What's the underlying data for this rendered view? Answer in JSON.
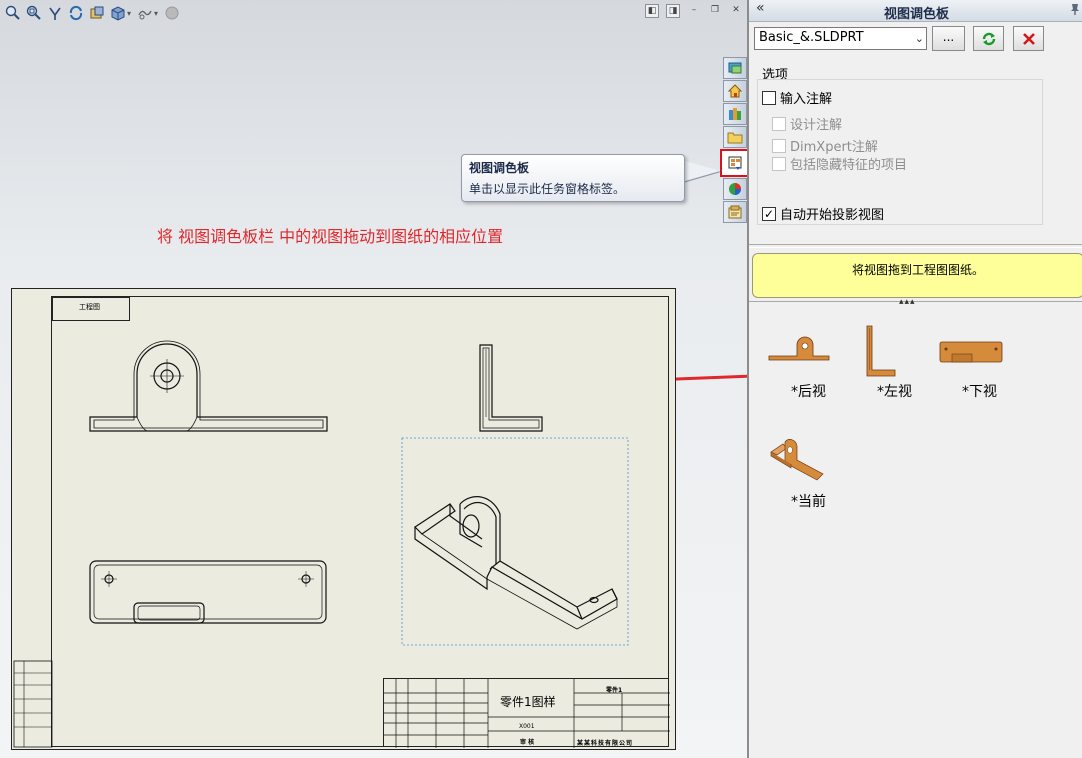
{
  "graphics": {
    "toolbar_icons": [
      "zoom-to-fit-icon",
      "zoom-area-icon",
      "previous-view-icon",
      "rebuild-icon",
      "section-view-icon",
      "view-orientation-icon",
      "display-style-icon",
      "hide-show-icon",
      "appearance-icon"
    ],
    "instruction": "将 视图调色板栏 中的视图拖动到图纸的相应位置",
    "tooltip": {
      "title": "视图调色板",
      "body": "单击以显示此任务窗格标签。"
    },
    "taskpane_tabs": [
      "solidworks-resources",
      "design-library",
      "file-explorer",
      "view-palette",
      "appearances",
      "custom-properties"
    ],
    "sheet": {
      "tag_text": "工程图",
      "title_block": {
        "part_name": "零件1图样",
        "material": "零件1",
        "part_number": "X001",
        "stamp": "审 核",
        "company": "某某科技有限公司"
      }
    }
  },
  "panel": {
    "title": "视图调色板",
    "file_select": "Basic_&.SLDPRT",
    "browse_label": "...",
    "options_title": "选项",
    "options": [
      {
        "label": "输入注解",
        "checked": false,
        "disabled": false
      },
      {
        "label": "设计注解",
        "checked": false,
        "disabled": true
      },
      {
        "label": "DimXpert注解",
        "checked": false,
        "disabled": true
      },
      {
        "label": "包括隐藏特征的项目",
        "checked": false,
        "disabled": true
      },
      {
        "label": "自动开始投影视图",
        "checked": true,
        "disabled": false
      }
    ],
    "hint": "将视图拖到工程图图纸。",
    "views": [
      {
        "label": "*后视"
      },
      {
        "label": "*左视"
      },
      {
        "label": "*下视"
      },
      {
        "label": "*当前"
      }
    ]
  },
  "colors": {
    "accent_red": "#e0282c",
    "hint_yellow": "#ffff99",
    "sheet": "#ebebdf",
    "part_orange": "#d68a3c"
  }
}
